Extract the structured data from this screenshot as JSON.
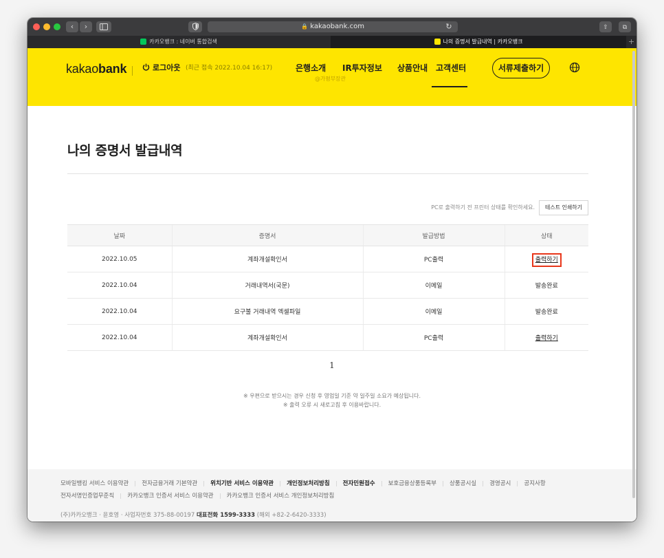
{
  "browser": {
    "url": "kakaobank.com",
    "tabs": [
      {
        "label": "카카오뱅크 : 네이버 통합검색",
        "favicon_color": "#03c75a"
      },
      {
        "label": "나의 증명서 발급내역 | 카카오뱅크",
        "favicon_color": "#fee500"
      }
    ],
    "new_tab_glyph": "+"
  },
  "header": {
    "logo_light": "kakao",
    "logo_bold": "bank",
    "logout_label": "로그아웃",
    "last_login": "(최근 접속 2022.10.04 16:17)",
    "nav": [
      "은행소개",
      "IR투자정보",
      "상품안내",
      "고객센터"
    ],
    "nav_sub": "@가평부장관",
    "submit_button": "서류제출하기",
    "accent_color": "#fee500"
  },
  "main": {
    "title": "나의 증명서 발급내역",
    "printer_note": "PC로 출력하기 전 프린터 상태를 확인하세요.",
    "test_print_button": "테스트 인쇄하기",
    "columns": [
      "날짜",
      "증명서",
      "발급방법",
      "상태"
    ],
    "rows": [
      {
        "date": "2022.10.05",
        "cert": "계좌개설확인서",
        "method": "PC출력",
        "status": "출력하기"
      },
      {
        "date": "2022.10.04",
        "cert": "거래내역서(국문)",
        "method": "이메일",
        "status": "발송완료"
      },
      {
        "date": "2022.10.04",
        "cert": "요구불 거래내역 엑셀파일",
        "method": "이메일",
        "status": "발송완료"
      },
      {
        "date": "2022.10.04",
        "cert": "계좌개설확인서",
        "method": "PC출력",
        "status": "출력하기"
      }
    ],
    "page": "1",
    "notice_1": "※ 우편으로 받으시는 경우 신청 후 영업일 기준 약 일주일 소요가 예상됩니다.",
    "notice_2": "※ 출력 오류 시 새로고침 후 이용바랍니다."
  },
  "footer": {
    "links_row1": [
      "모바일뱅킹 서비스 이용약관",
      "전자금융거래 기본약관",
      "위치기반 서비스 이용약관",
      "개인정보처리방침",
      "전자민원접수",
      "보호금융상품등록부",
      "상품공시실",
      "경영공시",
      "공지사항"
    ],
    "links_row2": [
      "전자서명인증업무준칙",
      "카카오뱅크 인증서 서비스 이용약관",
      "카카오뱅크 인증서 서비스 개인정보처리방침"
    ],
    "corp_prefix": "(주)카카오뱅크 · 윤호영 · 사업자번호 375-88-00197",
    "corp_phone_label": "대표전화 1599-3333",
    "corp_overseas": "(해외 +82-2-6420-3333)"
  }
}
